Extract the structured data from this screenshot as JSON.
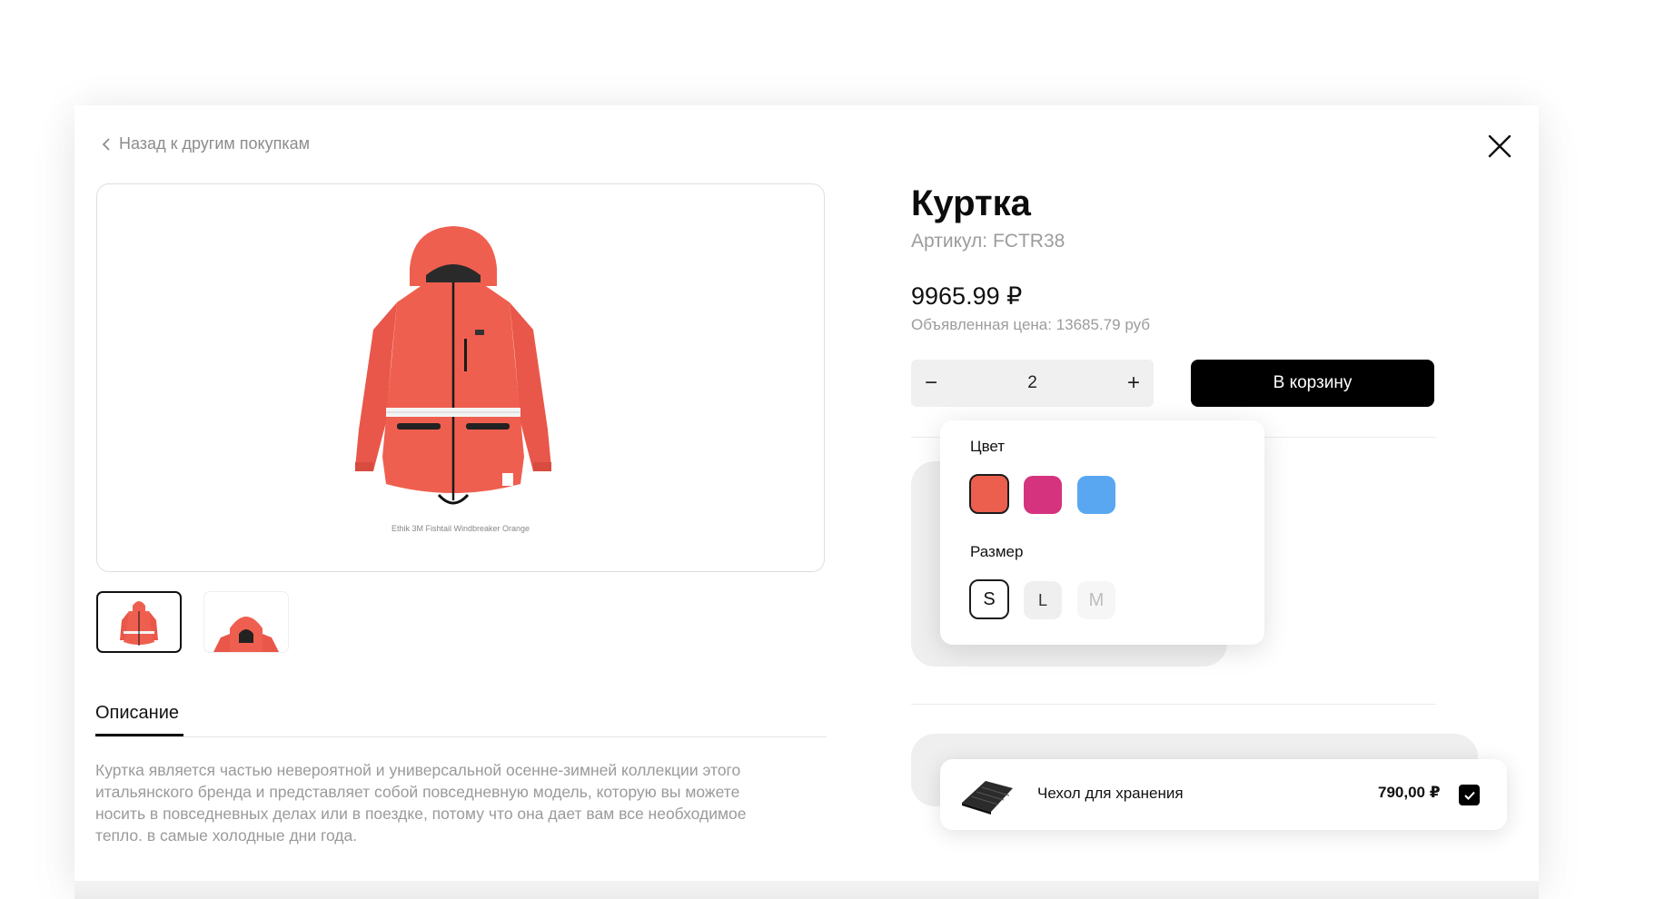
{
  "nav": {
    "back_label": "Назад к другим покупкам"
  },
  "gallery": {
    "caption": "Ethik 3M Fishtail Windbreaker Orange",
    "thumbnails": [
      "jacket-front",
      "jacket-hood"
    ]
  },
  "tabs": {
    "description_label": "Описание"
  },
  "description": {
    "line1": "Куртка является частью невероятной и универсальной осенне-зимней коллекции этого",
    "line2": "итальянского бренда и представляет собой повседневную модель, которую вы можете",
    "line3": "носить в повседневных делах или в поездке, потому что она дает вам все необходимое",
    "line4": "тепло. в самые холодные дни года."
  },
  "product": {
    "title": "Куртка",
    "sku": "Артикул: FCTR38",
    "price": "9965.99 ₽",
    "old_price": "Объявленная цена: 13685.79 руб"
  },
  "quantity": {
    "minus": "−",
    "value": "2",
    "plus": "+"
  },
  "cart_button": "В корзину",
  "options": {
    "color_label": "Цвет",
    "colors": [
      "#ec5e4e",
      "#d6337e",
      "#5aa7f1"
    ],
    "selected_color": "#ec5e4e",
    "size_label": "Размер",
    "sizes": [
      "S",
      "L",
      "M"
    ],
    "selected_size": "S",
    "disabled_size": "M"
  },
  "addon": {
    "name": "Чехол для хранения",
    "price": "790,00 ₽",
    "checked": true
  },
  "colors": {
    "accent": "#000000",
    "jacket": "#ef5f4f"
  }
}
